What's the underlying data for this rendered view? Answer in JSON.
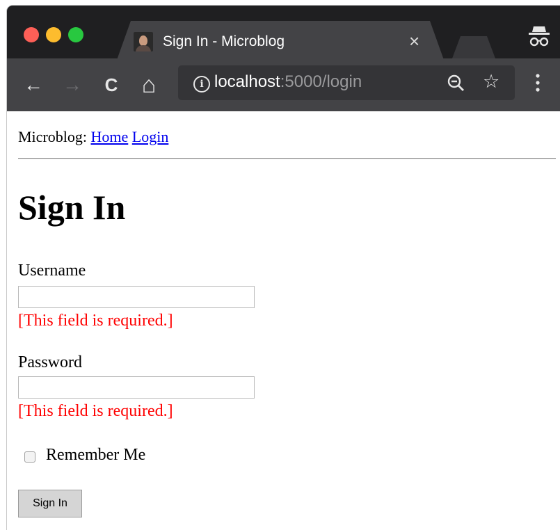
{
  "browser": {
    "tab": {
      "title": "Sign In - Microblog",
      "close_glyph": "×"
    },
    "toolbar": {
      "back_glyph": "←",
      "forward_glyph": "→",
      "reload_glyph": "C",
      "home_glyph": "⌂",
      "url_host": "localhost",
      "url_rest": ":5000/login",
      "info_glyph": "i",
      "star_glyph": "☆"
    },
    "icons": [
      "incognito-icon",
      "zoom-out-icon",
      "star-icon",
      "menu-icon"
    ],
    "colors": {
      "tabstrip": "#1f1f21",
      "toolbar": "#434346",
      "traffic_red": "#fd5f57",
      "traffic_yellow": "#fdbc2e",
      "traffic_green": "#28c840"
    }
  },
  "page": {
    "nav": {
      "prefix": "Microblog:",
      "home": "Home",
      "login": "Login"
    },
    "heading": "Sign In",
    "form": {
      "username_label": "Username",
      "username_value": "",
      "username_error": "[This field is required.]",
      "password_label": "Password",
      "password_value": "",
      "password_error": "[This field is required.]",
      "remember_label": "Remember Me",
      "remember_checked": false,
      "submit_label": "Sign In"
    },
    "colors": {
      "link": "#0000ee",
      "error": "#ff0000"
    }
  }
}
